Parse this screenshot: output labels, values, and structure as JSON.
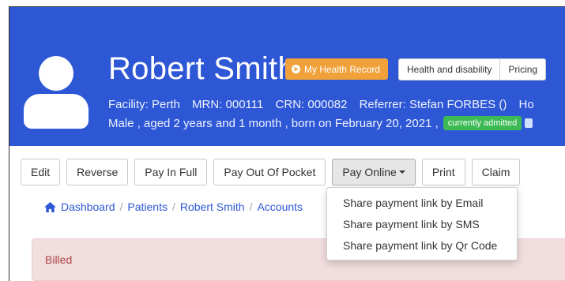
{
  "patient": {
    "name": "Robert Smith",
    "facility": "Facility: Perth",
    "mrn": "MRN: 000111",
    "crn": "CRN: 000082",
    "referrer": "Referrer: Stefan FORBES ()",
    "trailing": "Ho",
    "demographics": "Male , aged 2 years and 1 month , born on February 20, 2021 ,",
    "status_badge": "currently admitted"
  },
  "header_buttons": {
    "health_record": "My Health Record",
    "health_disability": "Health and disability",
    "pricing": "Pricing"
  },
  "actions": {
    "edit": "Edit",
    "reverse": "Reverse",
    "pay_in_full": "Pay In Full",
    "pay_out_of_pocket": "Pay Out Of Pocket",
    "pay_online": "Pay Online",
    "print": "Print",
    "claim": "Claim"
  },
  "dropdown": {
    "items": [
      "Share payment link by Email",
      "Share payment link by SMS",
      "Share payment link by Qr Code"
    ]
  },
  "breadcrumb": {
    "items": [
      "Dashboard",
      "Patients",
      "Robert Smith",
      "Accounts"
    ]
  },
  "alert": {
    "text": "Billed"
  },
  "colors": {
    "header_bg": "#2e57d6",
    "health_record_btn": "#f0a13a",
    "admitted_badge": "#3cba54",
    "alert_bg": "#f2dede",
    "alert_text": "#a94442"
  },
  "icons": {
    "avatar": "user-avatar-icon",
    "health_record": "arrow-circle-right-icon",
    "home": "home-icon",
    "caret": "caret-down-icon"
  }
}
